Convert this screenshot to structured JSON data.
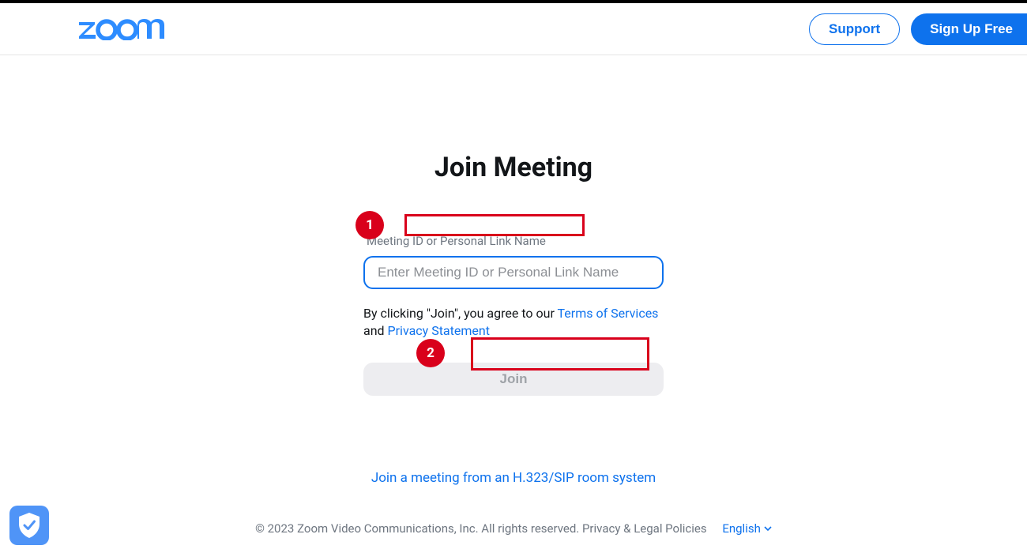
{
  "header": {
    "logo_text": "zoom",
    "support_label": "Support",
    "signup_label": "Sign Up Free"
  },
  "main": {
    "title": "Join Meeting",
    "field_label": "Meeting ID or Personal Link Name",
    "input_placeholder": "Enter Meeting ID or Personal Link Name",
    "input_value": "",
    "agree_prefix": "By clicking \"Join\", you agree to our ",
    "tos_label": "Terms of Services",
    "agree_conj": " and ",
    "privacy_label": "Privacy Statement",
    "join_label": "Join",
    "alt_link_label": "Join a meeting from an H.323/SIP room system"
  },
  "footer": {
    "copyright": "© 2023 Zoom Video Communications, Inc. All rights reserved. ",
    "policy_label": "Privacy & Legal Policies",
    "language_label": "English"
  },
  "annotations": {
    "one": "1",
    "two": "2"
  }
}
